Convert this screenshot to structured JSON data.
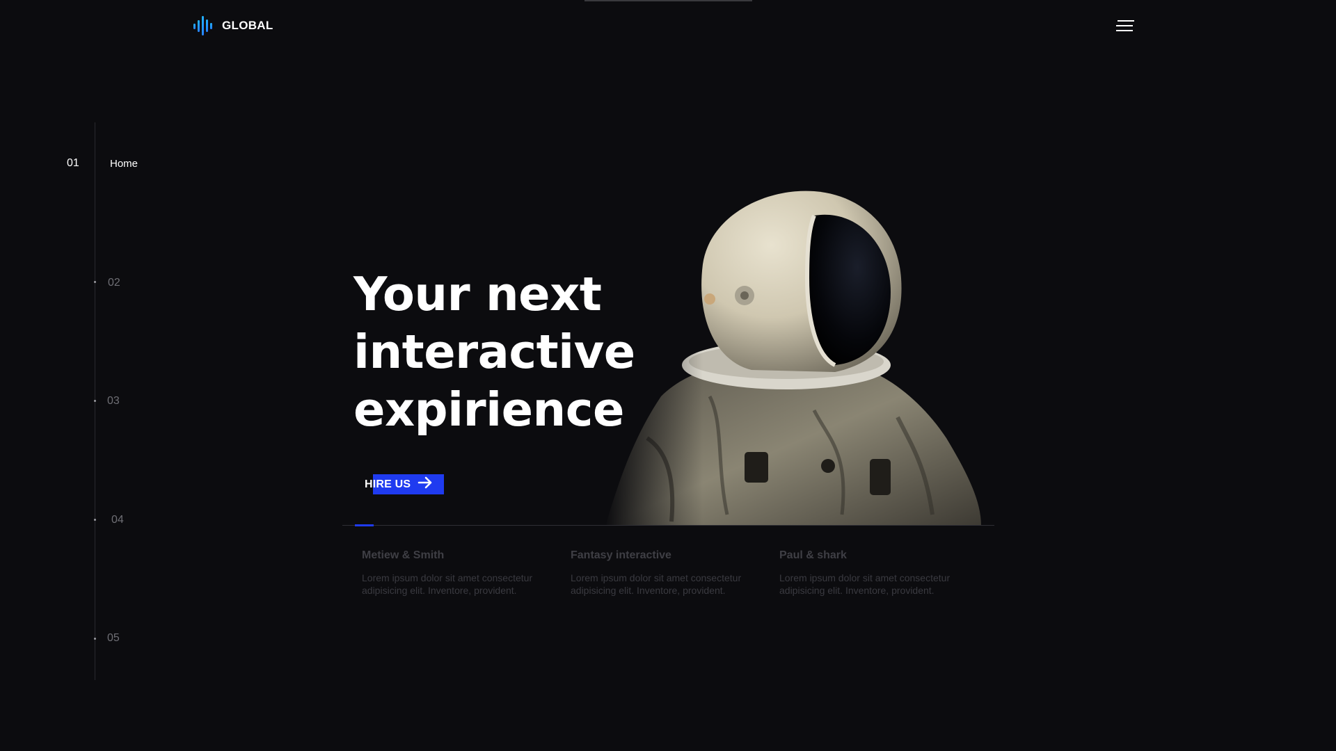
{
  "header": {
    "logo_text": "GLOBAL",
    "logo_icon": "sound-wave-icon",
    "menu_icon": "hamburger-menu-icon"
  },
  "side_nav": {
    "items": [
      {
        "number": "01",
        "label": "Home",
        "active": true
      },
      {
        "number": "02",
        "label": "",
        "active": false
      },
      {
        "number": "03",
        "label": "",
        "active": false
      },
      {
        "number": "04",
        "label": "",
        "active": false
      },
      {
        "number": "05",
        "label": "",
        "active": false
      }
    ]
  },
  "hero": {
    "title_lines": [
      "Your next",
      "interactive",
      "expirience"
    ],
    "button_label": "HIRE US",
    "button_icon": "arrow-right-icon",
    "image": "astronaut-photo"
  },
  "cards": [
    {
      "title": "Metiew & Smith",
      "text": "Lorem ipsum dolor sit amet consectetur adipisicing elit. Inventore, provident."
    },
    {
      "title": "Fantasy interactive",
      "text": "Lorem ipsum dolor sit amet consectetur adipisicing elit. Inventore, provident."
    },
    {
      "title": "Paul & shark",
      "text": "Lorem ipsum dolor sit amet consectetur adipisicing elit. Inventore, provident."
    }
  ],
  "colors": {
    "background": "#0c0c0f",
    "accent": "#1f3bf0",
    "logo_gradient_start": "#1ec8ff",
    "logo_gradient_end": "#2a6bff"
  }
}
